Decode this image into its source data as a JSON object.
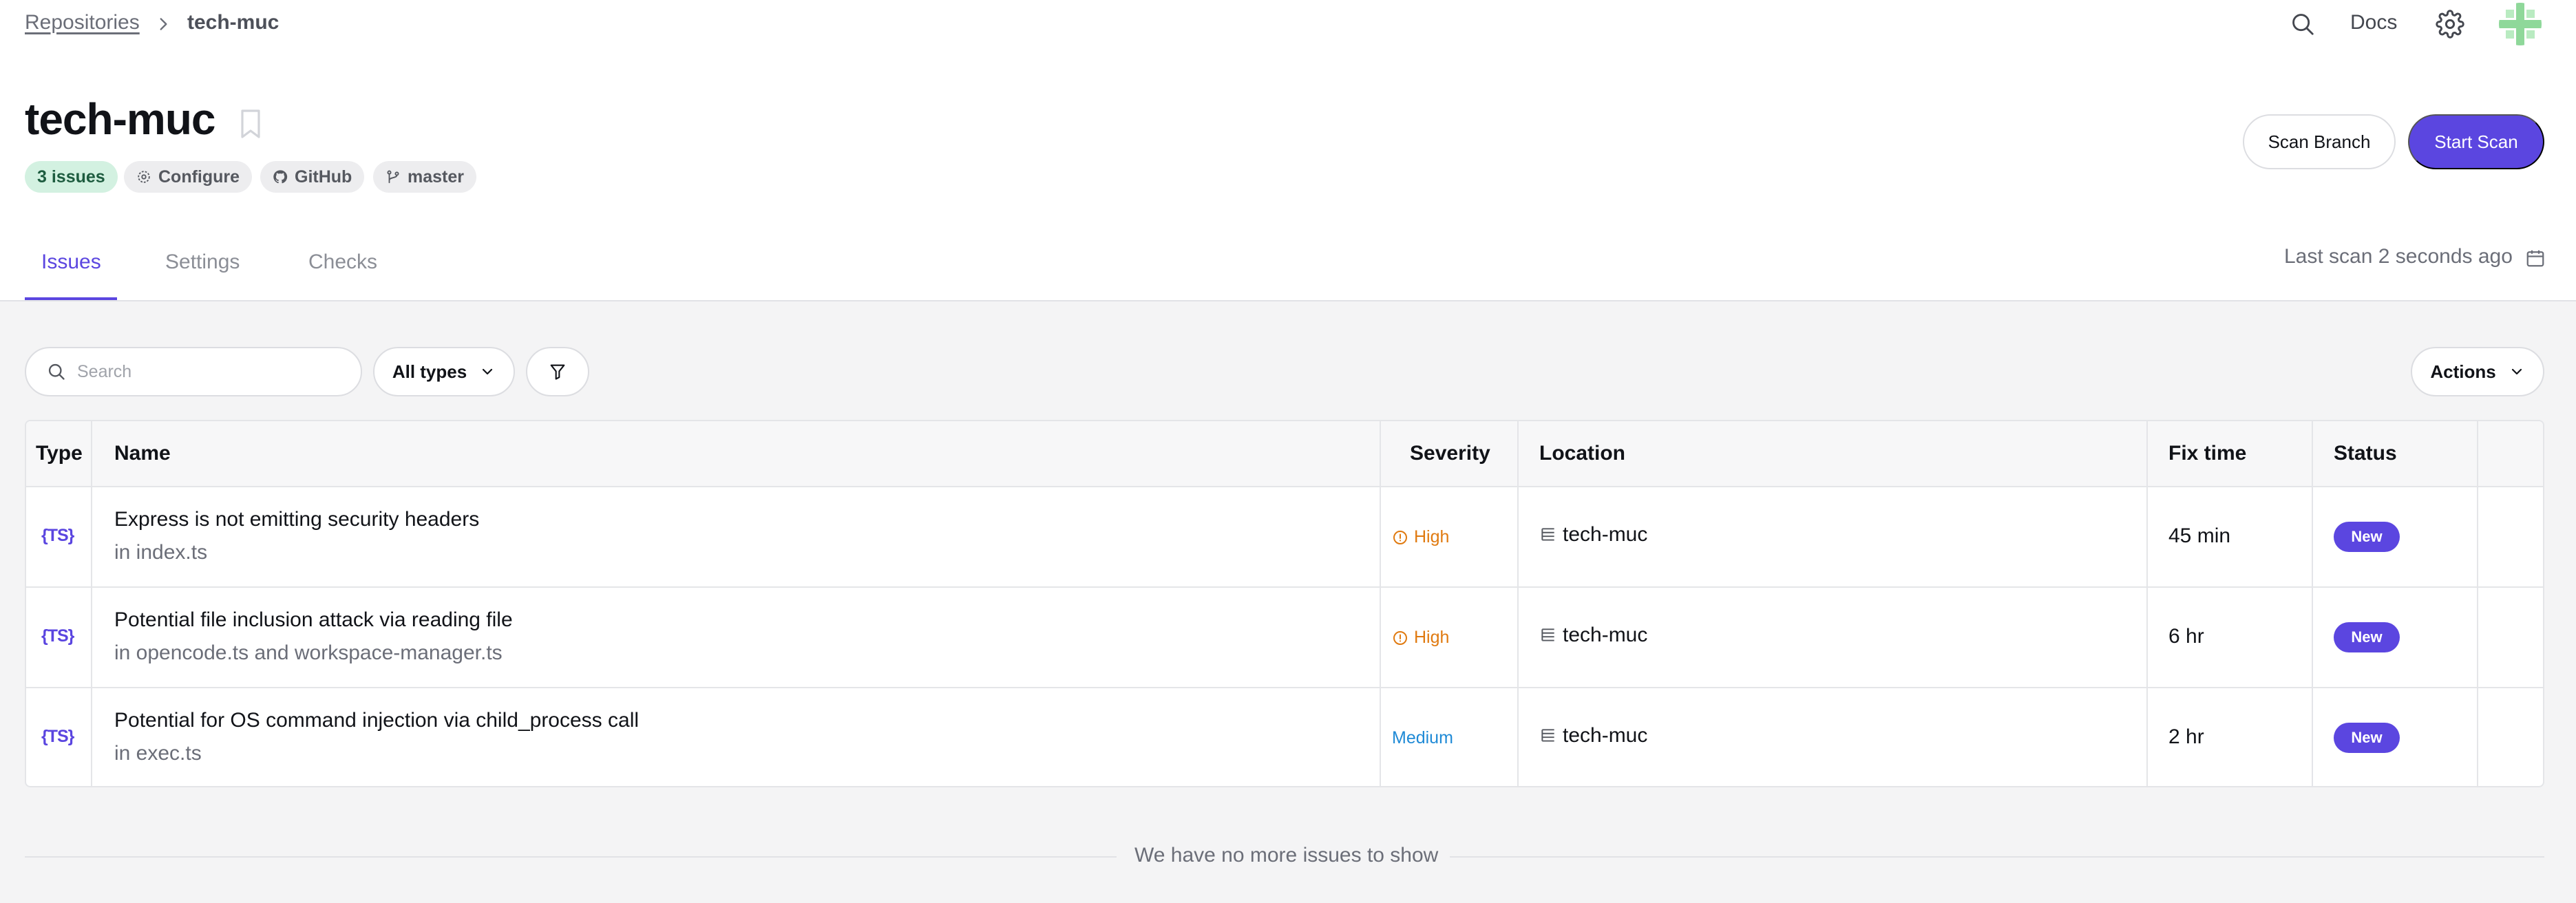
{
  "breadcrumb": {
    "root": "Repositories",
    "current": "tech-muc"
  },
  "topbar": {
    "docs_label": "Docs"
  },
  "repo": {
    "title": "tech-muc",
    "chips": {
      "issues": "3 issues",
      "configure": "Configure",
      "github": "GitHub",
      "branch": "master"
    }
  },
  "buttons": {
    "scan_branch": "Scan Branch",
    "start_scan": "Start Scan"
  },
  "tabs": [
    {
      "label": "Issues",
      "active": true
    },
    {
      "label": "Settings",
      "active": false
    },
    {
      "label": "Checks",
      "active": false
    }
  ],
  "last_scan": "Last scan 2 seconds ago",
  "toolbar": {
    "search_placeholder": "Search",
    "type_filter": "All types",
    "actions_label": "Actions"
  },
  "table": {
    "headers": {
      "type": "Type",
      "name": "Name",
      "severity": "Severity",
      "location": "Location",
      "fix_time": "Fix time",
      "status": "Status"
    },
    "rows": [
      {
        "type": "{TS}",
        "name": "Express is not emitting security headers",
        "file": "in index.ts",
        "severity": "High",
        "location": "tech-muc",
        "fix_time": "45 min",
        "status": "New"
      },
      {
        "type": "{TS}",
        "name": "Potential file inclusion attack via reading file",
        "file": "in opencode.ts and workspace-manager.ts",
        "severity": "High",
        "location": "tech-muc",
        "fix_time": "6 hr",
        "status": "New"
      },
      {
        "type": "{TS}",
        "name": "Potential for OS command injection via child_process call",
        "file": "in exec.ts",
        "severity": "Medium",
        "location": "tech-muc",
        "fix_time": "2 hr",
        "status": "New"
      }
    ]
  },
  "footer_text": "We have no more issues to show",
  "colors": {
    "accent": "#5b46e0",
    "severity_high": "#e07a10",
    "severity_medium": "#1f8ad6",
    "issues_chip_bg": "#d3f1e1"
  }
}
